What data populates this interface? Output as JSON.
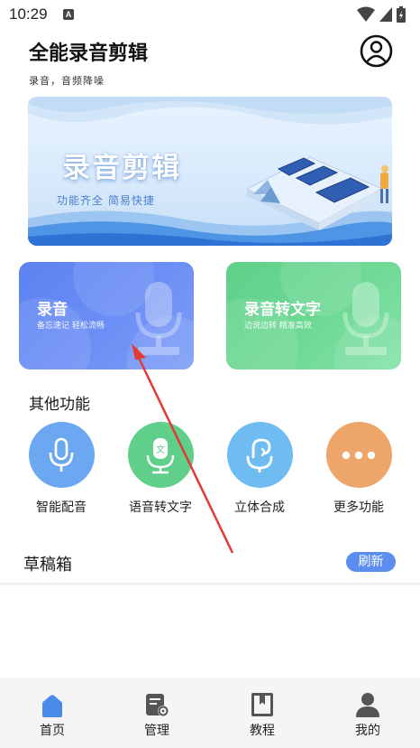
{
  "status_bar": {
    "time": "10:29",
    "indicator": "A",
    "icons": [
      "wifi-icon",
      "signal-icon",
      "battery-icon"
    ]
  },
  "header": {
    "title": "全能录音剪辑",
    "subtitle": "录音，音频降噪",
    "profile_icon": "user-circle-icon"
  },
  "banner": {
    "title": "录音剪辑",
    "tagline": "功能齐全 简易快捷"
  },
  "cards": [
    {
      "title": "录音",
      "subtitle": "备忘速记 轻松流畅",
      "icon": "microphone-icon",
      "color": "#5c82f2"
    },
    {
      "title": "录音转文字",
      "subtitle": "边说边转 精准高效",
      "icon": "microphone-icon",
      "color": "#5fd089"
    }
  ],
  "other_functions": {
    "title": "其他功能",
    "items": [
      {
        "label": "智能配音",
        "icon": "microphone-icon",
        "color": "#6ca8f2"
      },
      {
        "label": "语音转文字",
        "icon": "text-microphone-icon",
        "color": "#5fcf8a"
      },
      {
        "label": "立体合成",
        "icon": "stereo-icon",
        "color": "#6ebcf2"
      },
      {
        "label": "更多功能",
        "icon": "more-dots-icon",
        "color": "#eea56a"
      }
    ]
  },
  "drafts": {
    "title": "草稿箱",
    "refresh_label": "刷新"
  },
  "bottom_nav": {
    "items": [
      {
        "label": "首页",
        "icon": "home-icon",
        "active": true
      },
      {
        "label": "管理",
        "icon": "manage-icon",
        "active": false
      },
      {
        "label": "教程",
        "icon": "tutorial-icon",
        "active": false
      },
      {
        "label": "我的",
        "icon": "profile-icon",
        "active": false
      }
    ]
  },
  "colors": {
    "accent": "#5c8ef0",
    "annotation_arrow": "#e53935"
  }
}
